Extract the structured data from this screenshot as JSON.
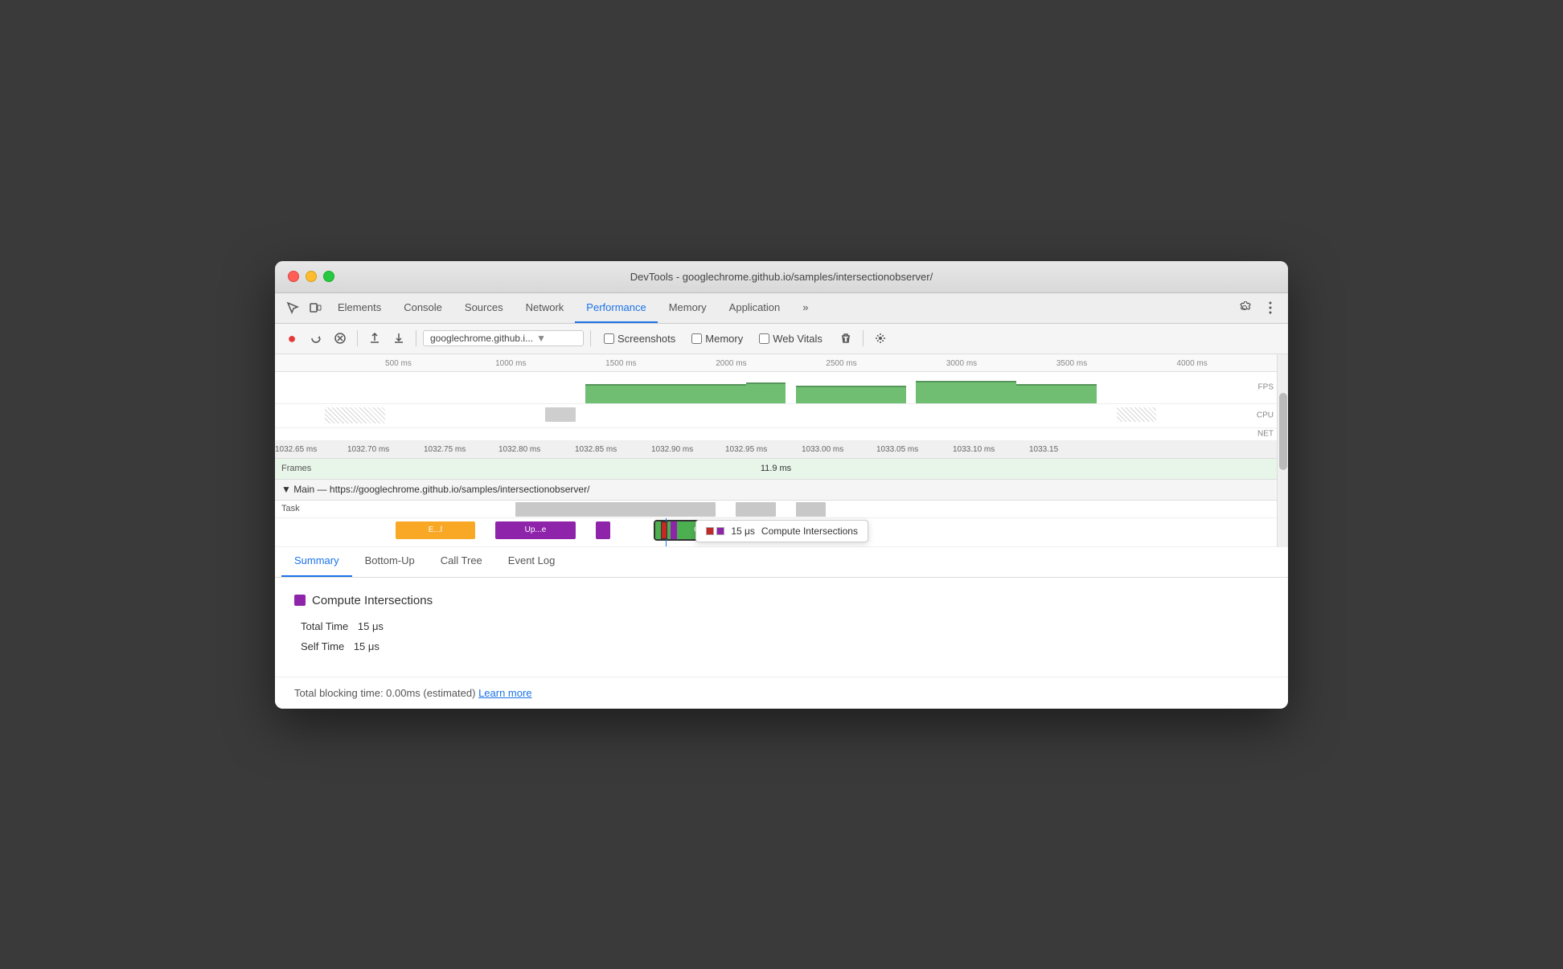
{
  "window": {
    "title": "DevTools - googlechrome.github.io/samples/intersectionobserver/"
  },
  "devtools_tabs": {
    "items": [
      {
        "label": "Elements",
        "active": false
      },
      {
        "label": "Console",
        "active": false
      },
      {
        "label": "Sources",
        "active": false
      },
      {
        "label": "Network",
        "active": false
      },
      {
        "label": "Performance",
        "active": true
      },
      {
        "label": "Memory",
        "active": false
      },
      {
        "label": "Application",
        "active": false
      }
    ]
  },
  "toolbar": {
    "url_text": "googlechrome.github.i...",
    "screenshots_label": "Screenshots",
    "memory_label": "Memory",
    "web_vitals_label": "Web Vitals"
  },
  "timeline": {
    "ruler_labels": [
      "500 ms",
      "1000 ms",
      "1500 ms",
      "2000 ms",
      "2500 ms",
      "3000 ms",
      "3500 ms",
      "4000 ms"
    ],
    "fps_label": "FPS",
    "cpu_label": "CPU",
    "net_label": "NET",
    "time_markers": [
      "1032.65 ms",
      "1032.70 ms",
      "1032.75 ms",
      "1032.80 ms",
      "1032.85 ms",
      "1032.90 ms",
      "1032.95 ms",
      "1033.00 ms",
      "1033.05 ms",
      "1033.10 ms",
      "1033.15"
    ],
    "frames_label": "Frames",
    "frame_duration": "11.9 ms",
    "main_thread_label": "▼ Main — https://googlechrome.github.io/samples/intersectionobserver/",
    "task_label": "Task",
    "task_blocks": [
      {
        "label": "E...l",
        "color": "#f9a825",
        "left_pct": 14,
        "width_pct": 6
      },
      {
        "label": "Up...e",
        "color": "#8e24aa",
        "left_pct": 24,
        "width_pct": 6
      },
      {
        "label": "",
        "color": "#8e24aa",
        "left_pct": 32,
        "width_pct": 1
      },
      {
        "label": "Co...rs",
        "color": "#4caf50",
        "left_pct": 40,
        "width_pct": 10
      },
      {
        "label": "",
        "color": "#9e9e9e",
        "left_pct": 43,
        "width_pct": 5
      },
      {
        "label": "",
        "color": "#9e9e9e",
        "left_pct": 51,
        "width_pct": 4
      }
    ],
    "cursor_position_pct": 39,
    "tooltip": {
      "time": "15 μs",
      "label": "Compute Intersections",
      "color": "#8e24aa"
    }
  },
  "bottom_tabs": {
    "items": [
      {
        "label": "Summary",
        "active": true
      },
      {
        "label": "Bottom-Up",
        "active": false
      },
      {
        "label": "Call Tree",
        "active": false
      },
      {
        "label": "Event Log",
        "active": false
      }
    ]
  },
  "summary": {
    "title": "Compute Intersections",
    "color": "#8e24aa",
    "total_time_label": "Total Time",
    "total_time_value": "15 μs",
    "self_time_label": "Self Time",
    "self_time_value": "15 μs",
    "footer_text": "Total blocking time: 0.00ms (estimated)",
    "learn_more_label": "Learn more"
  }
}
